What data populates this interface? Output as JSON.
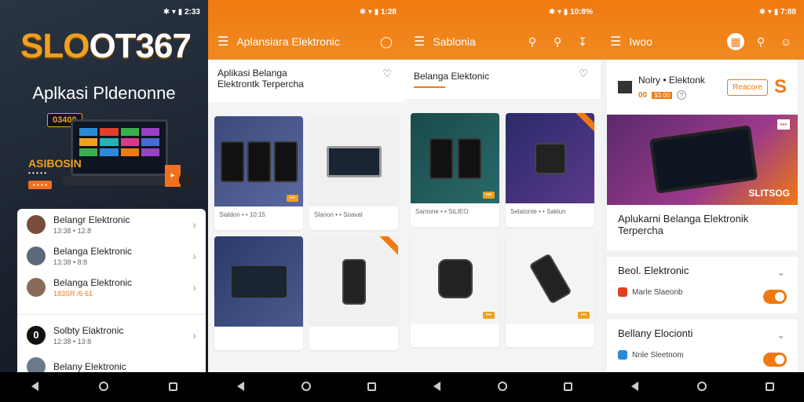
{
  "screen1": {
    "status": "✱ ▾ ▮ 2:33",
    "brand_a": "SLO",
    "brand_b": "OT367",
    "app_title": "Aplkasi Pldenonne",
    "promo_badge": "03400",
    "promo_big": "ASIBOSIN",
    "promo_small": "• • • • •",
    "promo_pill": "• • • •",
    "list": [
      {
        "title": "Belangr Elektronic",
        "sub": "13:38 • 12.8"
      },
      {
        "title": "Belanga Elektronic",
        "sub": "13:38 • 8:8"
      },
      {
        "title": "Belanga Elektronic",
        "sub": "183SR /6 61"
      },
      {
        "title": "Solbty Elaktronic",
        "sub": "12:38 • 13:8"
      },
      {
        "title": "Belany Elektronic",
        "sub": ""
      }
    ]
  },
  "screen2": {
    "status": "✱ ▾ ▮ 1:28",
    "title": "Aplansiara Elektronic",
    "sub1": "Aplikasi Belanga",
    "sub2": "Elektrontk Terpercha",
    "captions": [
      "Sialdon • • 10:15",
      "Slanon • • Soaval",
      "",
      ""
    ]
  },
  "screen3": {
    "status": "✱ ▾ ▮ 10:8%",
    "title": "Sablonia",
    "sub": "Belanga Elektonic",
    "captions": [
      "Samone • • SiLIEO",
      "Selatonte • • Saklun",
      "",
      ""
    ]
  },
  "screen4": {
    "status": "✱ ▾ ▮ 7:88",
    "title": "Iwoo",
    "head_title": "Nolry • Elektonk",
    "head_price": "00",
    "head_tag": "$3.00",
    "head_btn": "Reacore",
    "banner_tag": "SLITSOG",
    "desc": "Aplukarni Belanga Elektronik Terpercha",
    "acc1": {
      "title": "Beol. Elektronic",
      "sub": "Marle Slaeonb"
    },
    "acc2": {
      "title": "Bellany Elocionti",
      "sub": "Nnle Sleetnom"
    }
  },
  "colors": {
    "accent": "#F07A10",
    "brand": "#F0A020"
  }
}
